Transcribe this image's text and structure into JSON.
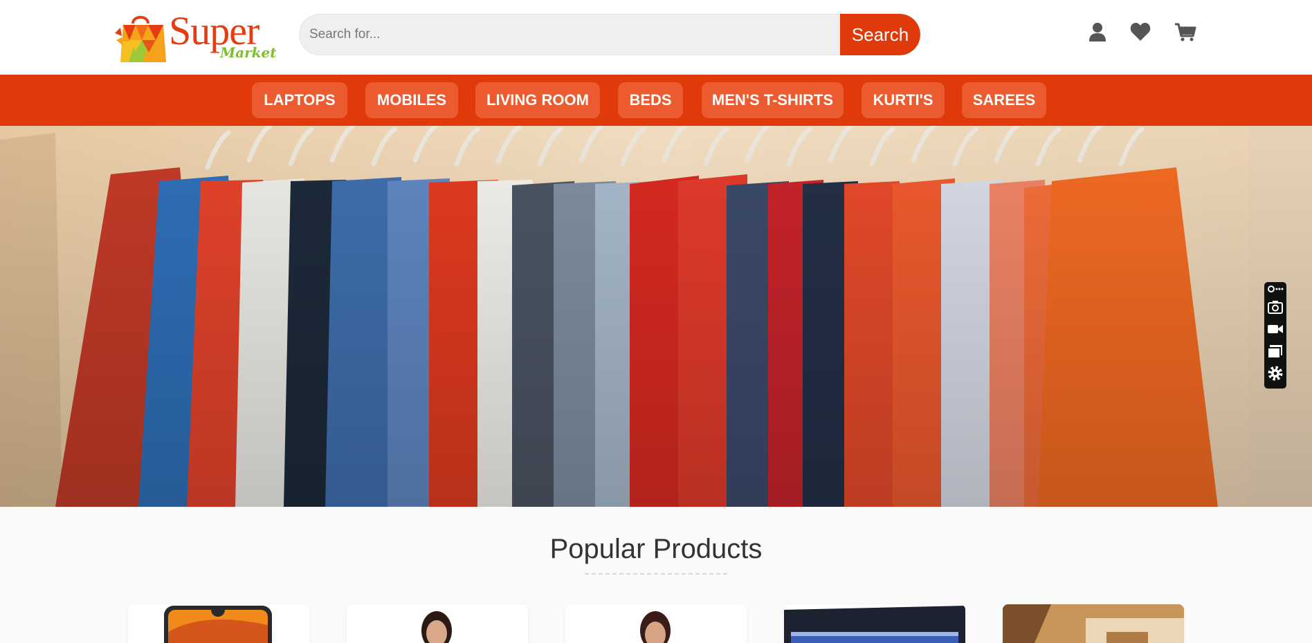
{
  "brand": {
    "name": "Super",
    "tagline": "Market"
  },
  "search": {
    "placeholder": "Search for...",
    "button_label": "Search"
  },
  "header_icons": [
    "user-icon",
    "heart-icon",
    "cart-icon"
  ],
  "nav": {
    "items": [
      {
        "label": "LAPTOPS"
      },
      {
        "label": "MOBILES"
      },
      {
        "label": "LIVING ROOM"
      },
      {
        "label": "BEDS"
      },
      {
        "label": "MEN'S T-SHIRTS"
      },
      {
        "label": "KURTI'S"
      },
      {
        "label": "SAREES"
      }
    ]
  },
  "hero": {
    "image": "hanging-clothes-rack"
  },
  "extension_toolbar": {
    "icons": [
      "link-more-icon",
      "camera-icon",
      "video-icon",
      "window-icon",
      "gear-icon"
    ]
  },
  "popular": {
    "title": "Popular Products",
    "products": [
      {
        "thumbnail": "smartphone"
      },
      {
        "thumbnail": "woman-model"
      },
      {
        "thumbnail": "woman-model-saree"
      },
      {
        "thumbnail": "laptop"
      },
      {
        "thumbnail": "living-room"
      }
    ]
  },
  "colors": {
    "accent": "#e03a0b",
    "nav_pill": "#ec5b2f",
    "brand_red": "#e53c12",
    "brand_green": "#7bbf2a",
    "page_bg": "#fafafa"
  }
}
